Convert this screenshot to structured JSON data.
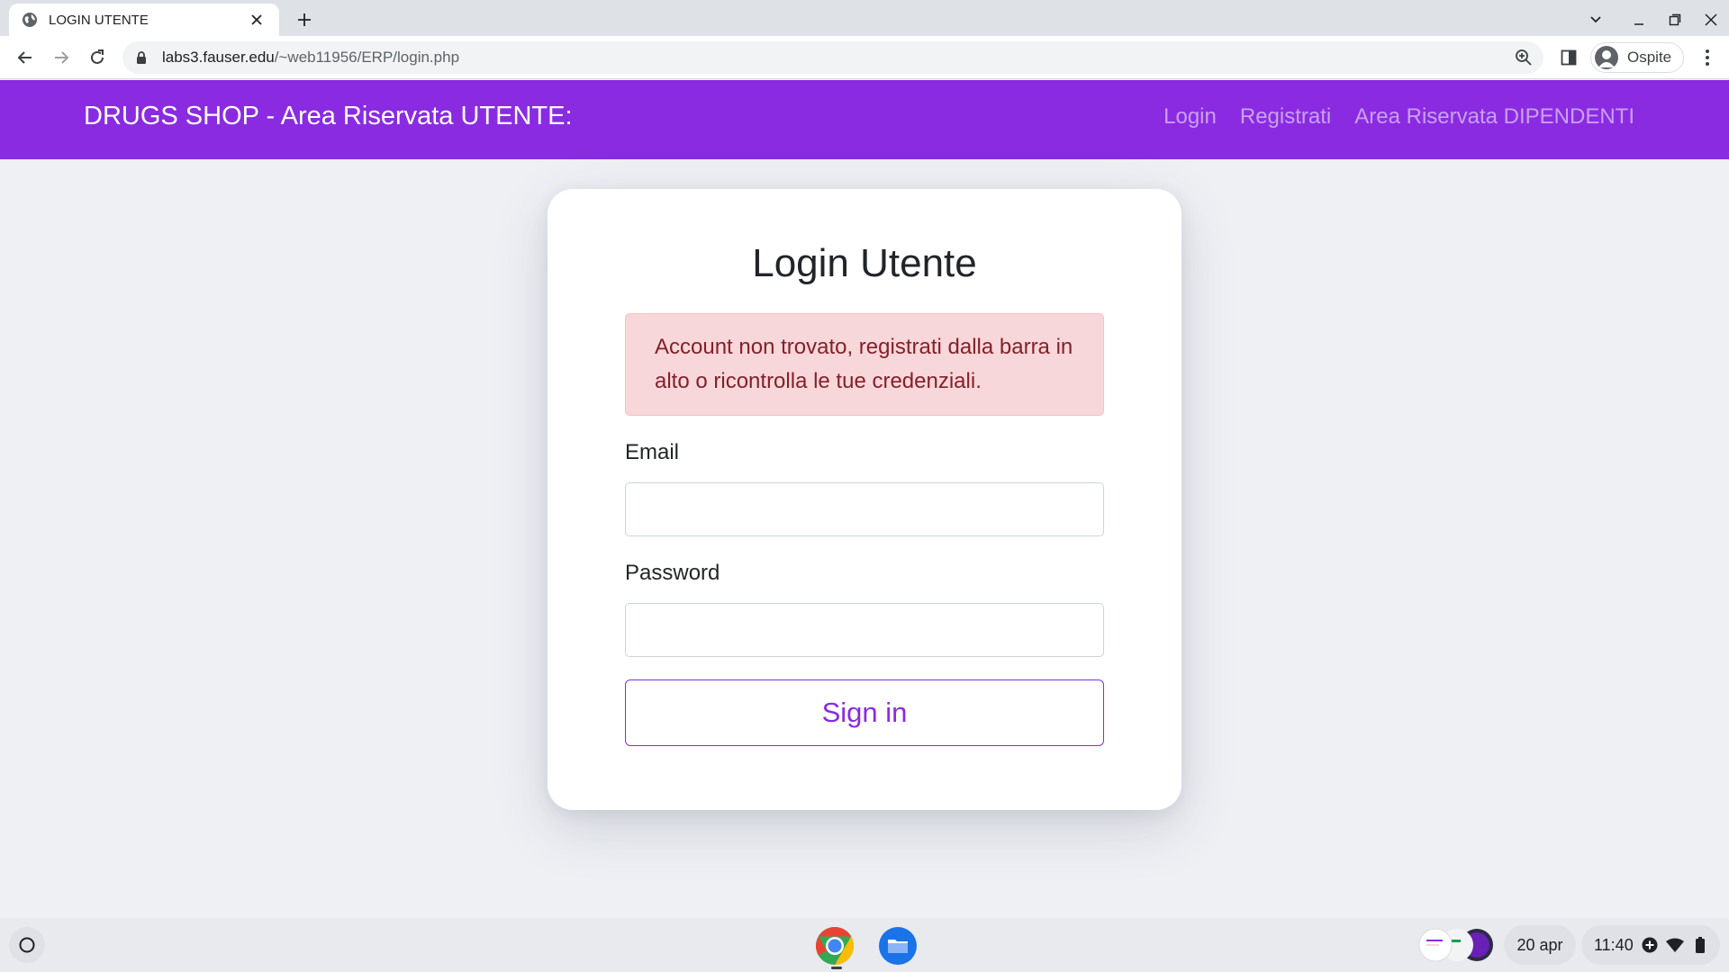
{
  "browser": {
    "tab_title": "LOGIN UTENTE",
    "url_host": "labs3.fauser.edu",
    "url_path": "/~web11956/ERP/login.php",
    "profile_label": "Ospite"
  },
  "navbar": {
    "brand": "DRUGS SHOP - Area Riservata UTENTE:",
    "links": [
      {
        "label": "Login"
      },
      {
        "label": "Registrati"
      },
      {
        "label": "Area Riservata DIPENDENTI"
      }
    ],
    "bg_color": "#8a2be2"
  },
  "login": {
    "title": "Login Utente",
    "alert": "Account non trovato, registrati dalla barra in alto o ricontrolla le tue credenziali.",
    "email_label": "Email",
    "email_value": "",
    "password_label": "Password",
    "password_value": "",
    "submit_label": "Sign in"
  },
  "shelf": {
    "date": "20 apr",
    "time": "11:40",
    "apps": [
      "chrome-icon",
      "files-icon"
    ]
  }
}
